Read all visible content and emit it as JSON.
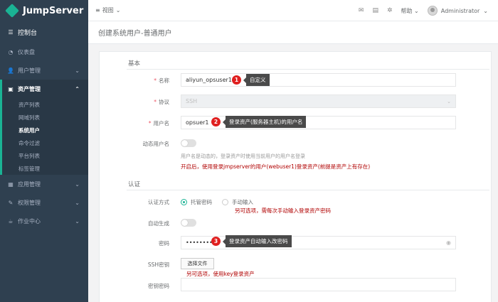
{
  "app": {
    "name": "JumpServer"
  },
  "sidebar": {
    "home": "控制台",
    "items": [
      {
        "label": "仪表盘",
        "icon": "dashboard-icon"
      },
      {
        "label": "用户管理",
        "icon": "users-icon"
      },
      {
        "label": "资产管理",
        "icon": "inbox-icon"
      },
      {
        "label": "应用管理",
        "icon": "apps-icon"
      },
      {
        "label": "权限管理",
        "icon": "edit-icon"
      },
      {
        "label": "作业中心",
        "icon": "coffee-icon"
      }
    ],
    "asset_submenu": [
      "资产列表",
      "网域列表",
      "系统用户",
      "命令过滤",
      "平台列表",
      "标签管理"
    ],
    "current_sub": "系统用户"
  },
  "topbar": {
    "view_label": "视图",
    "help_label": "帮助",
    "user_name": "Administrator"
  },
  "page": {
    "title": "创建系统用户-普通用户"
  },
  "form": {
    "basic_section": "基本",
    "name_label": "名称",
    "name_value": "aliyun_opsuser1",
    "protocol_label": "协议",
    "protocol_value": "SSH",
    "username_label": "用户名",
    "username_value": "opsuer1",
    "dynamic_label": "动态用户名",
    "dynamic_help": "用户名是动态的，登录资产时使用当前用户的用户名登录",
    "auth_section": "认证",
    "auth_method_label": "认证方式",
    "auth_option_managed": "托管密码",
    "auth_option_manual": "手动输入",
    "auto_gen_label": "自动生成",
    "password_label": "密码",
    "password_value": "••••••••",
    "ssh_key_label": "SSH密钥",
    "file_button": "选择文件",
    "key_password_label": "密钥密码"
  },
  "annotations": {
    "badge1": "1",
    "callout1": "自定义",
    "badge2": "2",
    "callout2": "登录资产(服务器主机)的用户名",
    "note_dynamic": "开启后，使用登录jmpserver的用户(webuser1)登录资产(前提是资产上有存在)",
    "note_manual": "另可选项，需每次手动输入登录资产密码",
    "badge3": "3",
    "callout3": "登录资产自动输入改密码",
    "note_ssh": "另可选项，使用key登录资产"
  },
  "colors": {
    "sidebar_bg": "#2f4050",
    "accent": "#1ab394",
    "annotation_red": "#b00000",
    "badge_red": "#e02020"
  }
}
